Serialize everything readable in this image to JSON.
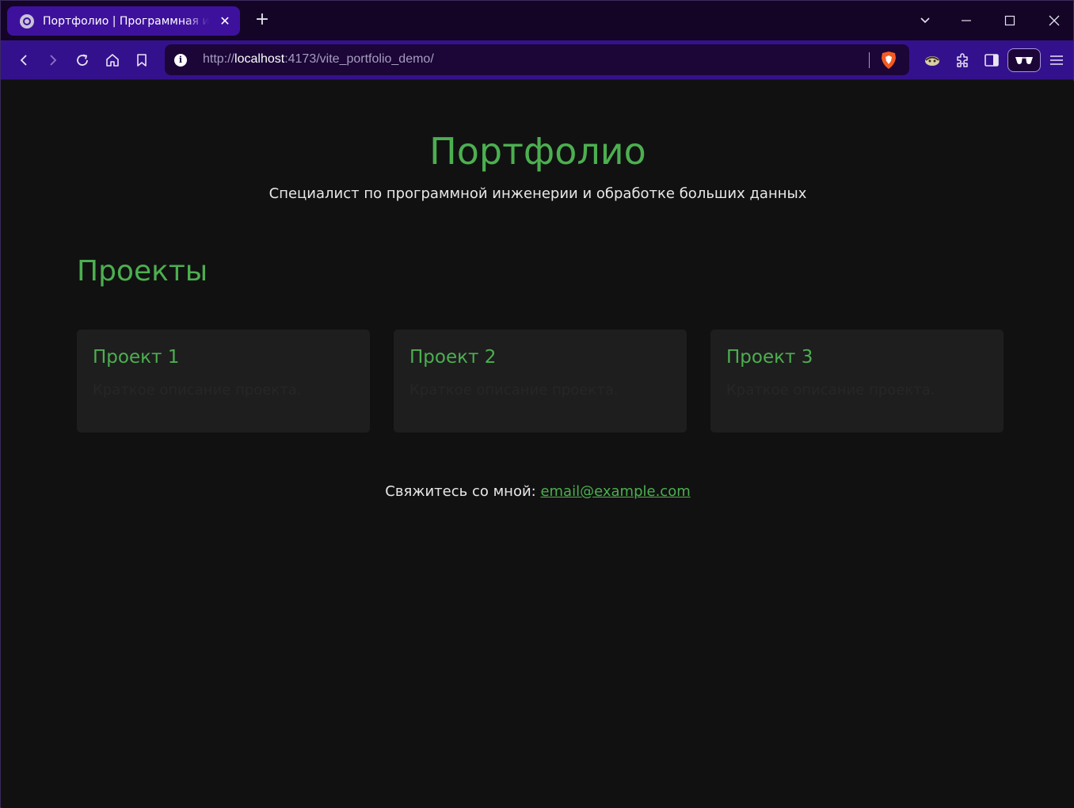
{
  "browser": {
    "tab": {
      "title": "Портфолио | Программная инженерия",
      "close_glyph": "✕"
    },
    "new_tab_glyph": "+",
    "url": {
      "scheme": "http://",
      "host": "localhost",
      "rest": ":4173/vite_portfolio_demo/"
    },
    "accent_color": "#3d119c",
    "toolbar_color": "#34118c"
  },
  "header": {
    "title": "Портфолио",
    "subtitle": "Специалист по программной инженерии и обработке больших данных"
  },
  "projects": {
    "heading": "Проекты",
    "items": [
      {
        "title": "Проект 1",
        "description": "Краткое описание проекта."
      },
      {
        "title": "Проект 2",
        "description": "Краткое описание проекта."
      },
      {
        "title": "Проект 3",
        "description": "Краткое описание проекта."
      }
    ]
  },
  "footer": {
    "text": "Свяжитесь со мной: ",
    "email": "email@example.com"
  },
  "colors": {
    "accent": "#4caf50",
    "background": "#111111",
    "card": "#1e1e1e"
  }
}
